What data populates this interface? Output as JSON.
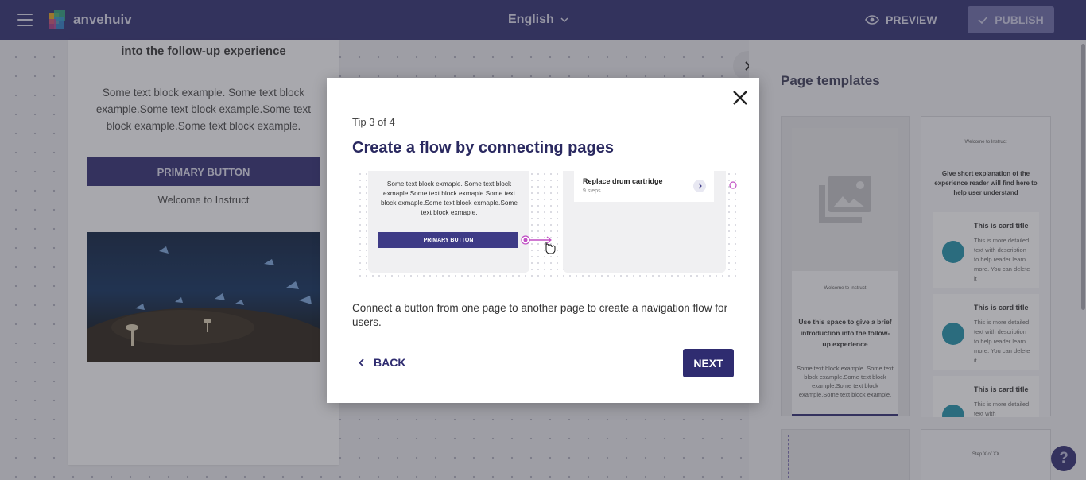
{
  "topbar": {
    "brand": "anvehuiv",
    "language": "English",
    "preview_label": "PREVIEW",
    "publish_label": "PUBLISH"
  },
  "page_card": {
    "intro": "into the follow-up experience",
    "text": "Some text block example. Some text block example.Some text block example.Some text block example.Some text block example.",
    "button": "PRIMARY BUTTON",
    "welcome": "Welcome to Instruct"
  },
  "templates": {
    "title": "Page templates",
    "tpl1": {
      "welcome": "Welcome to Instruct",
      "intro": "Use this space to give a brief introduction into the follow-up experience",
      "text": "Some text block example. Some text block example.Some text block example.Some text block example.Some text block example."
    },
    "tpl2": {
      "welcome": "Welcome to Instruct",
      "intro": "Give short explanation of the experience reader will find here to help user understand",
      "card_title": "This is card title",
      "card_desc": "This is more detailed text with description to help reader learn more. You can delete it",
      "card_desc_short": "This is more detailed text with"
    },
    "tpl4": {
      "step": "Step X of XX"
    }
  },
  "modal": {
    "tip": "Tip 3 of 4",
    "title": "Create a flow by connecting pages",
    "description": "Connect a button from one page to another page to create a navigation flow for users.",
    "back_label": "BACK",
    "next_label": "NEXT",
    "illustration": {
      "text": "Some text block exmaple. Some text block exmaple.Some text block exmaple.Some text block exmaple.Some text block exmaple.Some text block exmaple.",
      "button": "PRIMARY BUTTON",
      "item_title": "Replace drum cartridge",
      "item_sub": "9 steps"
    }
  },
  "colors": {
    "topbar": "#2e2d6e",
    "primary": "#2f2c70",
    "accent_pink": "#c04fc4",
    "teal": "#1f8fa8"
  },
  "icons": {
    "menu": "hamburger-icon",
    "preview": "eye-icon",
    "publish": "check-icon",
    "close": "close-icon",
    "back": "chevron-left-icon",
    "help": "question-icon"
  }
}
